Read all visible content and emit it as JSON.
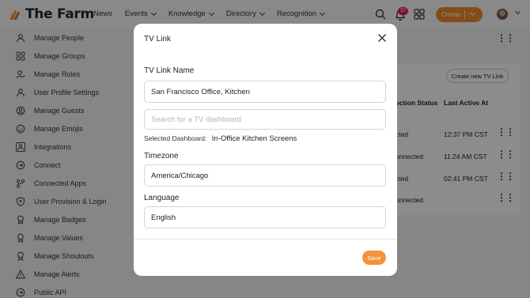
{
  "brand": {
    "name": "The Farm"
  },
  "nav": {
    "items": [
      {
        "label": "News",
        "has_menu": false
      },
      {
        "label": "Events",
        "has_menu": true
      },
      {
        "label": "Knowledge",
        "has_menu": true
      },
      {
        "label": "Directory",
        "has_menu": true
      },
      {
        "label": "Recognition",
        "has_menu": true
      }
    ],
    "notifications_count": "37",
    "create_label": "Create"
  },
  "sidebar": {
    "items": [
      {
        "label": "Manage People",
        "icon": "person-icon"
      },
      {
        "label": "Manage Groups",
        "icon": "groups-icon"
      },
      {
        "label": "Manage Roles",
        "icon": "roles-icon"
      },
      {
        "label": "User Profile Settings",
        "icon": "profile-settings-icon"
      },
      {
        "label": "Manage Guests",
        "icon": "guests-icon"
      },
      {
        "label": "Manage Emojis",
        "icon": "emoji-icon"
      },
      {
        "label": "Integrations",
        "icon": "integrations-icon"
      },
      {
        "label": "Connect",
        "icon": "connect-icon"
      },
      {
        "label": "Connected Apps",
        "icon": "connected-apps-icon"
      },
      {
        "label": "User Provision & Login",
        "icon": "shield-icon"
      },
      {
        "label": "Manage Badges",
        "icon": "badge-icon"
      },
      {
        "label": "Manage Values",
        "icon": "values-icon"
      },
      {
        "label": "Manage Shoutouts",
        "icon": "shoutouts-icon"
      },
      {
        "label": "Manage Alerts",
        "icon": "alert-icon"
      },
      {
        "label": "Public API",
        "icon": "api-icon"
      }
    ]
  },
  "background": {
    "create_tv_link_label": "Create new TV Link",
    "columns": [
      "ection Status",
      "Last Active At"
    ],
    "rows": [
      {
        "status": "cted",
        "last_active": "12:37 PM CST"
      },
      {
        "status": "onnected",
        "last_active": "11:24 AM CST"
      },
      {
        "status": "cted",
        "last_active": "02:41 PM CST"
      },
      {
        "status": "onnected",
        "last_active": ""
      }
    ]
  },
  "modal": {
    "title": "TV Link",
    "name_label": "TV Link Name",
    "name_value": "San Francisco Office, Kitchen",
    "search_placeholder": "Search for a TV dashboard",
    "selected_dashboard_label": "Selected Dashboard:",
    "selected_dashboard_value": "In-Office Kitchen Screens",
    "timezone_label": "Timezone",
    "timezone_value": "America/Chicago",
    "language_label": "Language",
    "language_value": "English",
    "save_label": "Save"
  },
  "colors": {
    "accent": "#f08a2c",
    "badge": "#e11d48"
  }
}
